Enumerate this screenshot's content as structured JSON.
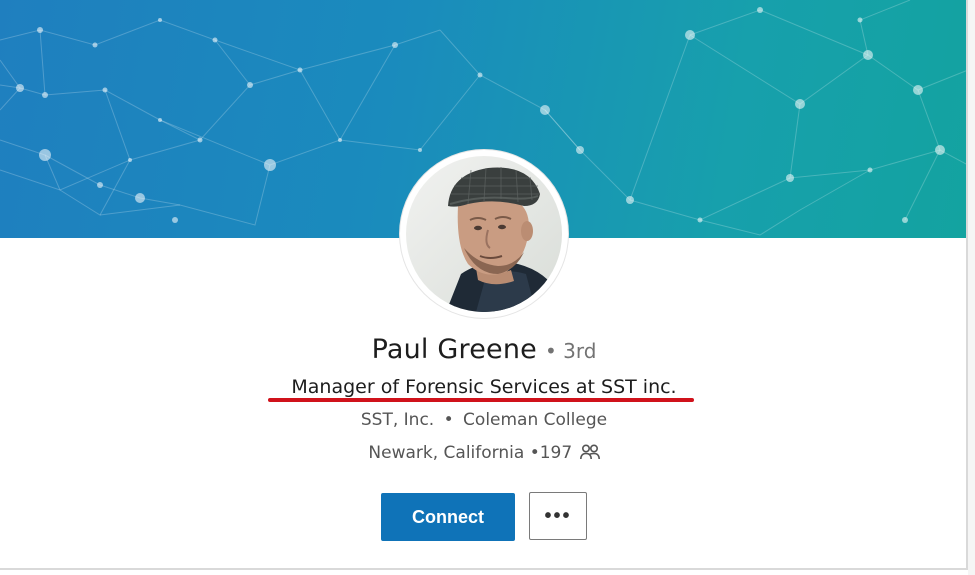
{
  "profile": {
    "name": "Paul Greene",
    "degree": "• 3rd",
    "headline": "Manager of Forensic Services at SST inc.",
    "company": "SST, Inc.",
    "separator": "•",
    "school": "Coleman College",
    "location": "Newark, California",
    "connections": "•197"
  },
  "actions": {
    "connect_label": "Connect",
    "more_label": "•••"
  },
  "icons": {
    "connections": "connections-icon",
    "banner": "network-pattern",
    "avatar": "profile-photo"
  },
  "colors": {
    "banner_start": "#1f7fbf",
    "banner_end": "#13a3a0",
    "connect_button": "#0f73b8",
    "annotation_underline": "#d0121b"
  }
}
